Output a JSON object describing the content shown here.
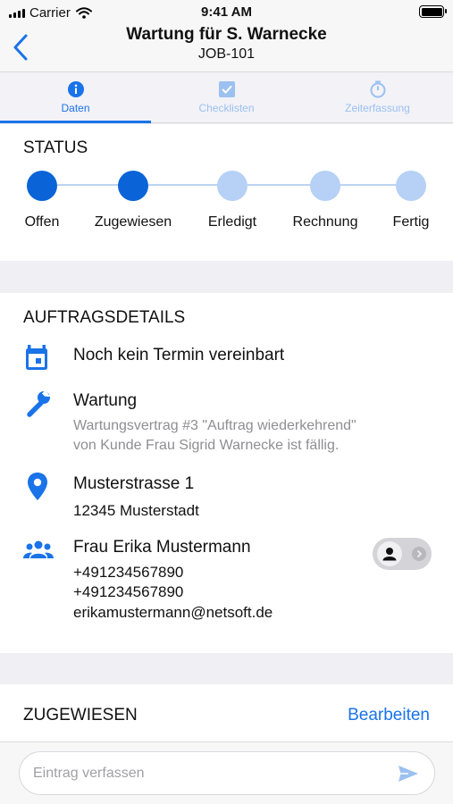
{
  "status_bar": {
    "carrier": "Carrier",
    "time": "9:41 AM"
  },
  "nav": {
    "title": "Wartung für S. Warnecke",
    "subtitle": "JOB-101",
    "back_icon": "chevron-left-icon"
  },
  "tabs": [
    {
      "label": "Daten",
      "icon": "info-icon",
      "active": true
    },
    {
      "label": "Checklisten",
      "icon": "checkbox-icon",
      "active": false
    },
    {
      "label": "Zeiterfassung",
      "icon": "stopwatch-icon",
      "active": false
    }
  ],
  "status": {
    "title": "STATUS",
    "steps": [
      {
        "label": "Offen",
        "done": true
      },
      {
        "label": "Zugewiesen",
        "done": true
      },
      {
        "label": "Erledigt",
        "done": false
      },
      {
        "label": "Rechnung",
        "done": false
      },
      {
        "label": "Fertig",
        "done": false
      }
    ]
  },
  "details": {
    "title": "AUFTRAGSDETAILS",
    "appointment": "Noch kein Termin vereinbart",
    "job_type": "Wartung",
    "job_description_line1": "Wartungsvertrag #3 \"Auftrag wiederkehrend\"",
    "job_description_line2": "von Kunde Frau Sigrid Warnecke ist fällig.",
    "street": "Musterstrasse 1",
    "city": "12345 Musterstadt",
    "contact_name": "Frau Erika Mustermann",
    "phone1": "+491234567890",
    "phone2": "+491234567890",
    "email": "erikamustermann@netsoft.de"
  },
  "assigned": {
    "title": "ZUGEWIESEN",
    "edit_label": "Bearbeiten"
  },
  "composer": {
    "placeholder": "Eintrag verfassen",
    "send_icon": "send-icon"
  },
  "colors": {
    "accent": "#1a73e8",
    "step_done": "#0a64d8",
    "step_todo": "#b6d1f5",
    "secondary_text": "#8e8e93"
  }
}
